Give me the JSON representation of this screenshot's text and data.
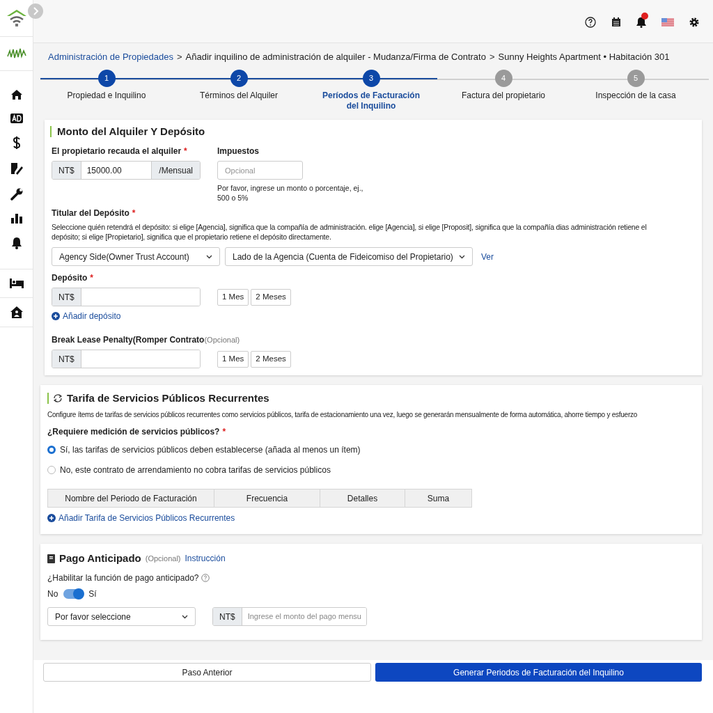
{
  "breadcrumb": [
    {
      "text": "Administración de Propiedades",
      "kind": "link"
    },
    {
      "text": ">",
      "kind": "separator"
    },
    {
      "text": "Añadir inquilino de administración de alquiler - Mudanza/Firma de Contrato",
      "kind": "text"
    },
    {
      "text": ">",
      "kind": "separator"
    },
    {
      "text": "Sunny Heights Apartment • Habitación 301",
      "kind": "text"
    }
  ],
  "steps": [
    {
      "number": "1",
      "label": "Propiedad e Inquilino",
      "completed": true,
      "selected": false
    },
    {
      "number": "2",
      "label": "Términos del Alquiler",
      "completed": true,
      "selected": false
    },
    {
      "number": "3",
      "label": "Períodos de Facturación del Inquilino",
      "completed": true,
      "selected": true
    },
    {
      "number": "4",
      "label": "Factura del propietario",
      "completed": false,
      "selected": false
    },
    {
      "number": "5",
      "label": "Inspección de la casa",
      "completed": false,
      "selected": false
    }
  ],
  "rent_section": {
    "title": "Monto del Alquiler Y Depósito",
    "rent": {
      "label": "El propietario recauda el alquiler",
      "required_mark": "*",
      "prefix": "NT$",
      "value": "15000.00",
      "suffix": "/Mensual"
    },
    "tax": {
      "label": "Impuestos",
      "placeholder": "Opcional",
      "hint": "Por favor, ingrese un monto o porcentaje, ej., 500 o 5%"
    },
    "holder": {
      "label": "Titular del Depósito",
      "required_mark": "*",
      "description": "Seleccione quién retendrá el depósito: si elige [Agencia], significa que la compañía de administración. elige [Agencia], si elige [Proposit], significa que la compañía dias administración retiene el depósito; si elige [Propietario], significa que el propietario retiene el depósito directamente.",
      "select_1": "Agency Side(Owner Trust Account)",
      "select_2": "Lado de la Agencia (Cuenta de Fideicomiso del Propietario)",
      "link": "Ver"
    },
    "deposit": {
      "label": "Depósito",
      "required_mark": "*",
      "prefix": "NT$",
      "quick_buttons": [
        "1 Mes",
        "2 Meses"
      ],
      "add_link": "Añadir depósito"
    },
    "penalty": {
      "label": "Break Lease Penalty(Romper Contrato",
      "optional_note": "(Opcional)",
      "prefix": "NT$",
      "quick_buttons": [
        "1 Mes",
        "2 Meses"
      ]
    }
  },
  "utilities_section": {
    "title": "Tarifa de Servicios Públicos Recurrentes",
    "description": "Configure ítems de tarifas de servicios públicos recurrentes como servicios públicos, tarifa de estacionamiento una vez, luego se generarán mensualmente de forma automática, ahorre tiempo y esfuerzo",
    "question": "¿Requiere medición de servicios públicos?",
    "required_mark": "*",
    "options": [
      {
        "label": "Sí, las tarifas de servicios públicos deben establecerse (añada al menos un ítem)",
        "selected": true
      },
      {
        "label": "No, este contrato de arrendamiento no cobra tarifas de servicios públicos",
        "selected": false
      }
    ],
    "table_columns": [
      "Nombre del Periodo de Facturación",
      "Frecuencia",
      "Detalles",
      "Suma"
    ],
    "add_link": "Añadir Tarifa de Servicios Públicos Recurrentes"
  },
  "prepay_section": {
    "title": "Pago Anticipado",
    "optional_note": "(Opcional)",
    "link": "Instrucción",
    "question": "¿Habilitar la función de pago anticipado?",
    "toggle": {
      "off_label": "No",
      "on_label": "Sí",
      "on": true
    },
    "select": "Por favor seleccione",
    "prefix": "NT$",
    "amount_placeholder": "Ingrese el monto del pago mensu"
  },
  "footer": {
    "back": "Paso Anterior",
    "next": "Generar Periodos de Facturación del Inquilino"
  }
}
